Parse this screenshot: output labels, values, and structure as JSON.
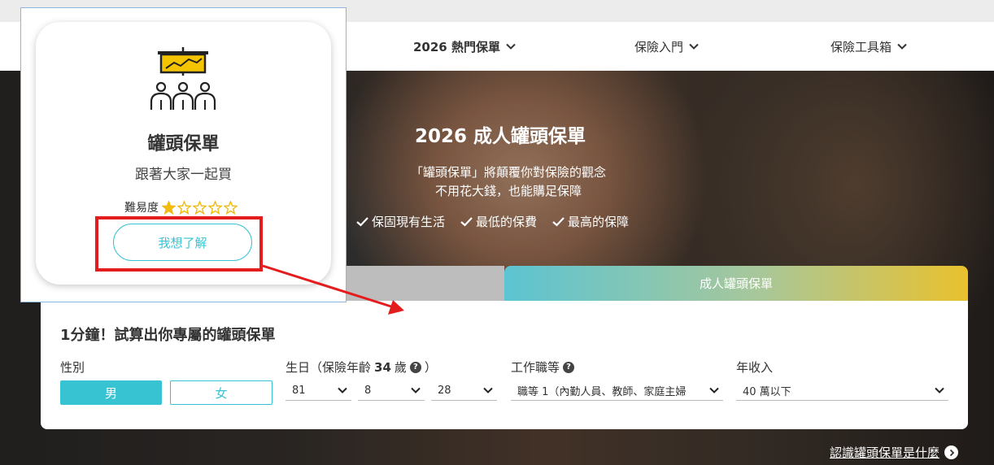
{
  "nav": {
    "items": [
      {
        "label": "2026 熱門保單",
        "icon": "chevron-down-icon"
      },
      {
        "label": "保險入門",
        "icon": "chevron-down-icon"
      },
      {
        "label": "保險工具箱",
        "icon": "chevron-down-icon"
      }
    ]
  },
  "hero": {
    "title": "2026 成人罐頭保單",
    "subtitle_line1": "「罐頭保單」將顛覆你對保險的觀念",
    "subtitle_line2": "不用花大錢，也能購足保障",
    "checks": [
      "保固現有生活",
      "最低的保費",
      "最高的保障"
    ]
  },
  "tabs": {
    "active_label": "成人罐頭保單"
  },
  "calculator": {
    "title": "1分鐘！試算出你專屬的罐頭保單",
    "gender": {
      "label": "性別",
      "male": "男",
      "female": "女",
      "selected": "男"
    },
    "birthday": {
      "label_prefix": "生日（保險年齡",
      "age": "34",
      "label_suffix": "歲",
      "close_paren": "）",
      "year": "81",
      "month": "8",
      "day": "28"
    },
    "job": {
      "label": "工作職等",
      "value": "職等 1（內勤人員、教師、家庭主婦"
    },
    "income": {
      "label": "年收入",
      "value": "40 萬以下"
    }
  },
  "learn_link": "認識罐頭保單是什麼",
  "card": {
    "title": "罐頭保單",
    "subtitle": "跟著大家一起買",
    "difficulty_label": "難易度",
    "difficulty_rating": 1,
    "difficulty_max": 5,
    "button": "我想了解"
  },
  "colors": {
    "accent": "#38c3d3",
    "highlight_red": "#e31d1d",
    "star": "#f2b90f",
    "icon_yellow": "#f5c400"
  }
}
